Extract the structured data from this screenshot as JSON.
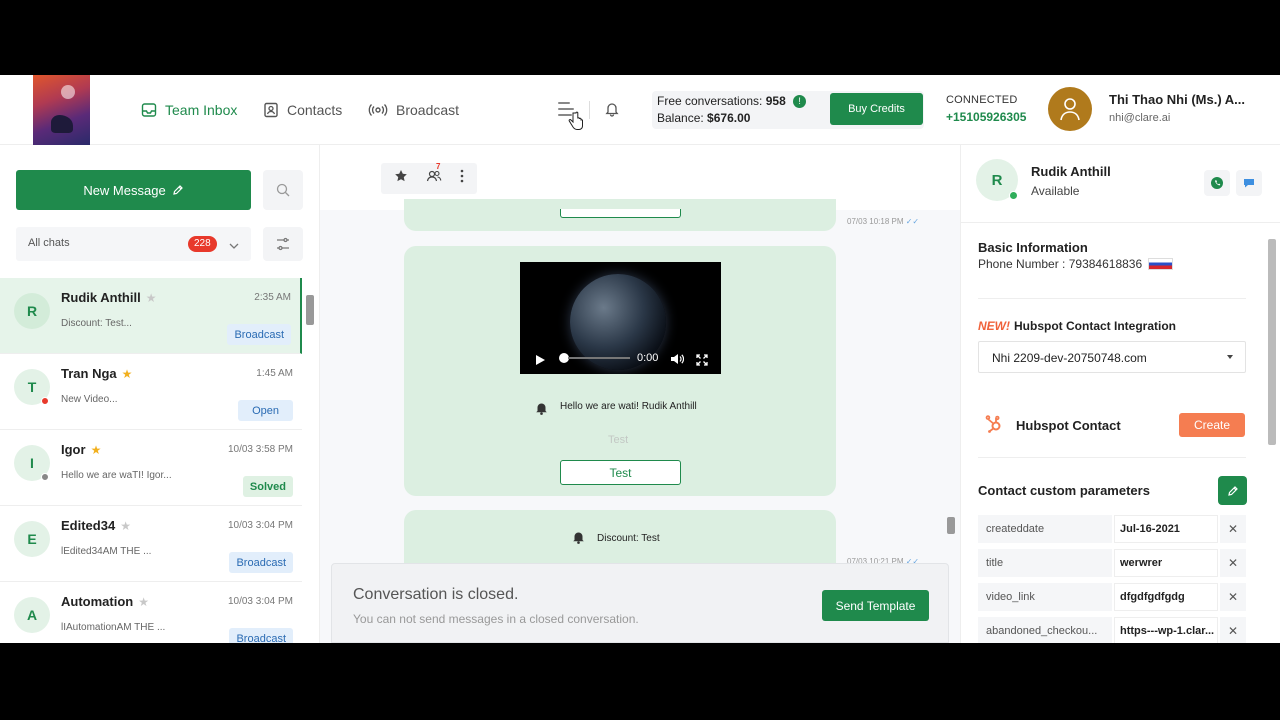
{
  "nav": {
    "team_inbox": "Team Inbox",
    "contacts": "Contacts",
    "broadcast": "Broadcast"
  },
  "credits": {
    "free_label": "Free conversations:",
    "free_value": "958",
    "balance_label": "Balance:",
    "balance_value": "$676.00",
    "buy_label": "Buy Credits"
  },
  "connection": {
    "status": "CONNECTED",
    "phone": "+15105926305"
  },
  "user": {
    "name": "Thi Thao Nhi (Ms.) A...",
    "email": "nhi@clare.ai"
  },
  "left": {
    "new_message_label": "New Message",
    "filter_label": "All chats",
    "filter_count": "228",
    "chats": [
      {
        "initial": "R",
        "name": "Rudik Anthill",
        "starred": false,
        "time": "2:35 AM",
        "preview": "Discount: Test...",
        "tag": "Broadcast",
        "tag_type": "b",
        "dot": ""
      },
      {
        "initial": "T",
        "name": "Tran Nga",
        "starred": true,
        "time": "1:45 AM",
        "preview": "New Video...",
        "tag": "Open",
        "tag_type": "o",
        "dot": "#e8392b"
      },
      {
        "initial": "I",
        "name": "Igor",
        "starred": true,
        "time": "10/03 3:58 PM",
        "preview": "Hello we are waTI! Igor...",
        "tag": "Solved",
        "tag_type": "s",
        "dot": "#888888"
      },
      {
        "initial": "E",
        "name": "Edited34",
        "starred": false,
        "time": "10/03 3:04 PM",
        "preview": "lEdited34AM THE ...",
        "tag": "Broadcast",
        "tag_type": "b",
        "dot": ""
      },
      {
        "initial": "A",
        "name": "Automation",
        "starred": false,
        "time": "10/03 3:04 PM",
        "preview": "lIAutomationAM THE ...",
        "tag": "Broadcast",
        "tag_type": "b",
        "dot": ""
      }
    ]
  },
  "middle": {
    "participants_badge": "7",
    "msg1_time": "07/03 10:18 PM",
    "video_time": "0:00",
    "msg2_text": "Hello we are wati! Rudik Anthill",
    "msg2_ghost": "Test",
    "msg2_button": "Test",
    "msg2_time": "07/03 10:21 PM",
    "msg3_text": "Discount: Test",
    "closed_title": "Conversation is closed.",
    "closed_sub": "You can not send messages in a closed conversation.",
    "send_template_label": "Send Template"
  },
  "right": {
    "contact_initial": "R",
    "contact_name": "Rudik Anthill",
    "contact_status": "Available",
    "basic_title": "Basic Information",
    "phone_label": "Phone Number :",
    "phone_value": "79384618836",
    "hub_new": "NEW!",
    "hub_title": "Hubspot Contact Integration",
    "hub_selected": "Nhi 2209-dev-20750748.com",
    "hub_contact_label": "Hubspot Contact",
    "create_label": "Create",
    "ccp_title": "Contact custom parameters",
    "params": [
      {
        "key": "createddate",
        "value": "Jul-16-2021"
      },
      {
        "key": "title",
        "value": "werwrer"
      },
      {
        "key": "video_link",
        "value": "dfgdfgdfgdg"
      },
      {
        "key": "abandoned_checkou...",
        "value": "https---wp-1.clar..."
      }
    ]
  },
  "colors": {
    "brand_green": "#1f8a4c",
    "accent_orange": "#f57d51",
    "badge_red": "#e8392b"
  }
}
